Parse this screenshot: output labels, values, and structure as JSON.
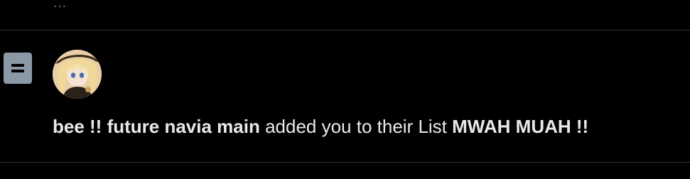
{
  "previous_item": {
    "fragment_text": "…"
  },
  "notification": {
    "icon": "list-icon",
    "avatar_alt": "bee !! future navia main avatar",
    "user_name": "bee !! future navia main",
    "action_text": " added you to their List ",
    "list_name": "MWAH MUAH !!"
  },
  "colors": {
    "background": "#000000",
    "divider": "#2f3336",
    "text_primary": "#e7e9ea",
    "text_secondary": "#71767b",
    "icon_fill": "#8b98a5"
  }
}
